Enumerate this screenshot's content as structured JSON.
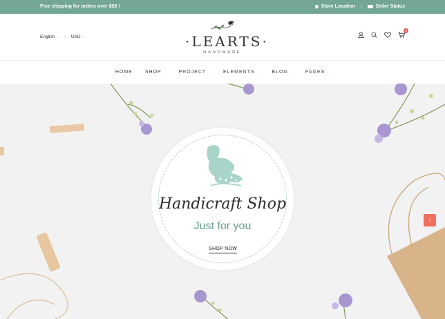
{
  "topbar": {
    "promo": "Free shipping for orders over $59 !",
    "store_location": "Store Location",
    "order_status": "Order Status",
    "bg_color": "#73a695"
  },
  "header": {
    "language": "English",
    "currency": "USD",
    "logo_name": "LEARTS",
    "logo_sub": "HANDMADE",
    "cart_count": "0",
    "icons": [
      "user-icon",
      "search-icon",
      "heart-icon",
      "cart-icon"
    ]
  },
  "nav": {
    "items": [
      {
        "label": "HOME"
      },
      {
        "label": "SHOP"
      },
      {
        "label": "PROJECT"
      },
      {
        "label": "ELEMENTS"
      },
      {
        "label": "BLOG"
      },
      {
        "label": "PAGES"
      }
    ]
  },
  "hero": {
    "script_title": "Handicraft Shop",
    "tagline": "Just for you",
    "cta_label": "SHOP NOW",
    "accent_color": "#6aa08e",
    "bird_color": "#a9d4c9"
  },
  "scroll_top": {
    "icon": "arrow-up-icon",
    "color": "#f0705d"
  }
}
